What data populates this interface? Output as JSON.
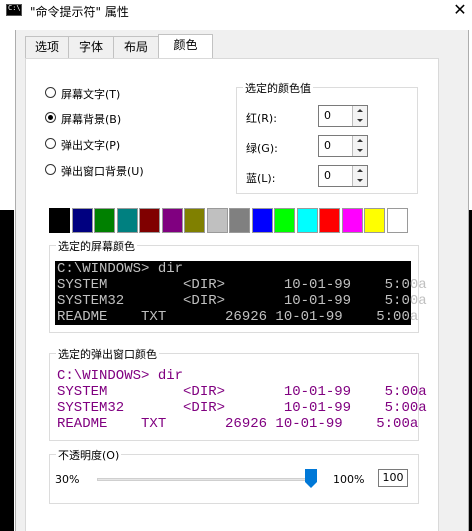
{
  "window": {
    "title": "\"命令提示符\" 属性",
    "icon_text": "C:\\",
    "close_glyph": "✕"
  },
  "tabs": [
    {
      "label": "选项",
      "active": false
    },
    {
      "label": "字体",
      "active": false
    },
    {
      "label": "布局",
      "active": false
    },
    {
      "label": "颜色",
      "active": true
    }
  ],
  "color_target": {
    "options": [
      {
        "label": "屏幕文字(T)",
        "selected": false
      },
      {
        "label": "屏幕背景(B)",
        "selected": true
      },
      {
        "label": "弹出文字(P)",
        "selected": false
      },
      {
        "label": "弹出窗口背景(U)",
        "selected": false
      }
    ]
  },
  "selected_color": {
    "title": "选定的颜色值",
    "red_label": "红(R):",
    "red_value": "0",
    "green_label": "绿(G):",
    "green_value": "0",
    "blue_label": "蓝(L):",
    "blue_value": "0"
  },
  "palette": [
    {
      "color": "#000000",
      "selected": true
    },
    {
      "color": "#000080",
      "selected": false
    },
    {
      "color": "#008000",
      "selected": false
    },
    {
      "color": "#008080",
      "selected": false
    },
    {
      "color": "#800000",
      "selected": false
    },
    {
      "color": "#800080",
      "selected": false
    },
    {
      "color": "#808000",
      "selected": false
    },
    {
      "color": "#c0c0c0",
      "selected": false
    },
    {
      "color": "#808080",
      "selected": false
    },
    {
      "color": "#0000ff",
      "selected": false
    },
    {
      "color": "#00ff00",
      "selected": false
    },
    {
      "color": "#00ffff",
      "selected": false
    },
    {
      "color": "#ff0000",
      "selected": false
    },
    {
      "color": "#ff00ff",
      "selected": false
    },
    {
      "color": "#ffff00",
      "selected": false
    },
    {
      "color": "#ffffff",
      "selected": false
    }
  ],
  "screen_preview": {
    "title": "选定的屏幕颜色",
    "background": "#000000",
    "text_color": "#c0c0c0",
    "lines": [
      "C:\\WINDOWS> dir",
      "SYSTEM         <DIR>       10-01-99    5:00a",
      "SYSTEM32       <DIR>       10-01-99    5:00a",
      "README    TXT       26926 10-01-99    5:00a"
    ]
  },
  "popup_preview": {
    "title": "选定的弹出窗口颜色",
    "background": "#ffffff",
    "text_color": "#800080",
    "lines": [
      "C:\\WINDOWS> dir",
      "SYSTEM         <DIR>       10-01-99    5:00a",
      "SYSTEM32       <DIR>       10-01-99    5:00a",
      "README    TXT       26926 10-01-99    5:00a"
    ]
  },
  "opacity": {
    "title": "不透明度(O)",
    "min_label": "30%",
    "max_label": "100%",
    "value": "100",
    "min": 30,
    "max": 100
  }
}
